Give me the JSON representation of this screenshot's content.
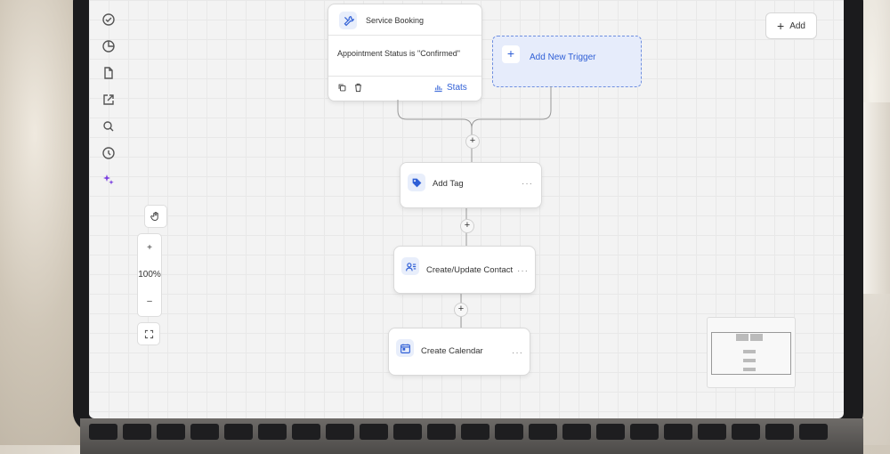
{
  "toolbar": {
    "add_label": "Add"
  },
  "zoom": {
    "level": "100%",
    "plus": "+",
    "minus": "–"
  },
  "workflow": {
    "trigger": {
      "title": "Service Booking",
      "condition": "Appointment Status is \"Confirmed\"",
      "stats_label": "Stats"
    },
    "add_trigger_label": "Add New Trigger",
    "actions": [
      {
        "label": "Add Tag",
        "more": "···"
      },
      {
        "label": "Create/Update Contact",
        "more": "···"
      },
      {
        "label": "Create Calendar",
        "more": "···"
      }
    ],
    "plus_symbol": "+"
  },
  "colors": {
    "accent": "#2f5fd6",
    "trigger_bg": "#e6ecfb",
    "active_nav": "#7a3fe0"
  },
  "icons": {
    "nav": [
      "check-circle-icon",
      "pie-chart-icon",
      "document-icon",
      "external-link-icon",
      "search-icon",
      "history-icon",
      "sparkles-icon"
    ],
    "trigger": "tools-icon",
    "actions": [
      "tag-icon",
      "contact-icon",
      "calendar-icon"
    ]
  }
}
